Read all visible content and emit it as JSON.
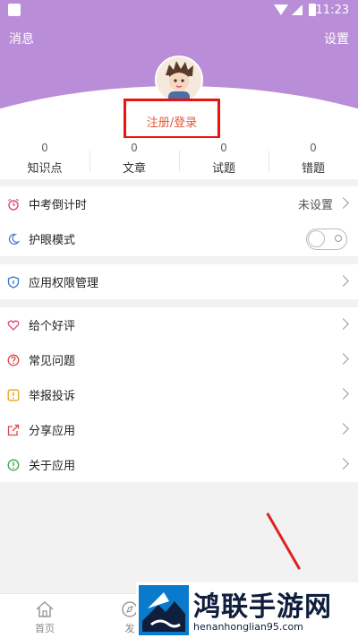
{
  "status_bar": {
    "time": "11:23"
  },
  "header": {
    "messages_label": "消息",
    "settings_label": "设置"
  },
  "profile": {
    "login_label": "注册/登录"
  },
  "stats": [
    {
      "value": "0",
      "label": "知识点"
    },
    {
      "value": "0",
      "label": "文章"
    },
    {
      "value": "0",
      "label": "试题"
    },
    {
      "value": "0",
      "label": "错题"
    }
  ],
  "menu": {
    "countdown": {
      "label": "中考倒计时",
      "value": "未设置"
    },
    "eye_mode": {
      "label": "护眼模式",
      "enabled": false
    },
    "permissions": {
      "label": "应用权限管理"
    },
    "rate": {
      "label": "给个好评"
    },
    "faq": {
      "label": "常见问题"
    },
    "report": {
      "label": "举报投诉"
    },
    "share": {
      "label": "分享应用"
    },
    "about": {
      "label": "关于应用"
    }
  },
  "tabbar": {
    "home_label": "首页",
    "post_label": "发"
  },
  "watermark": {
    "name": "鸿联手游网",
    "site": "henanhonglian95.com"
  },
  "colors": {
    "header_bg": "#b98dd8",
    "login_text": "#e05a3a",
    "highlight_box": "#e11111"
  }
}
